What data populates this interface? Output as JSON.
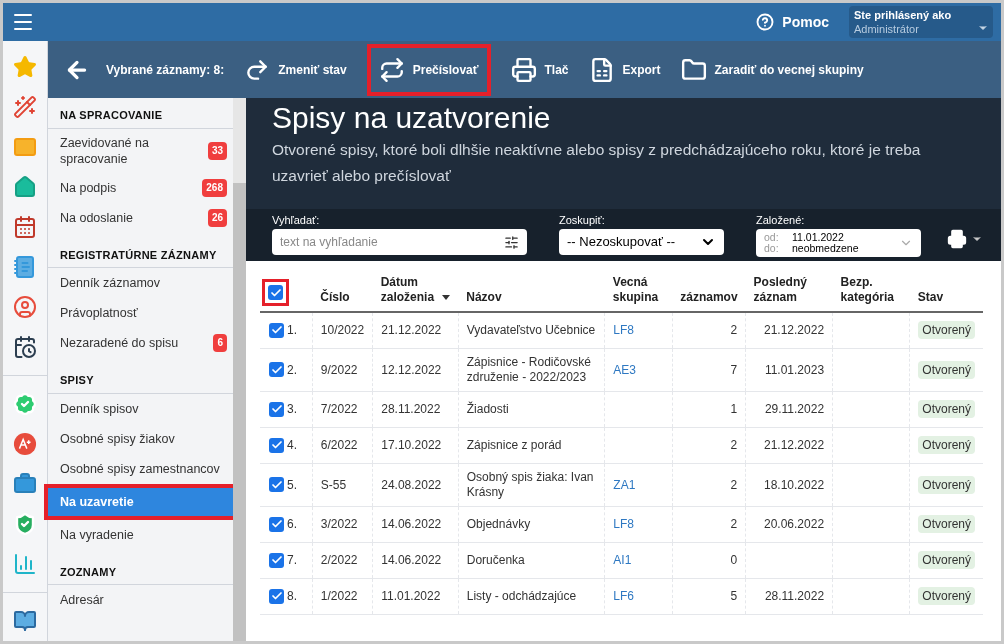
{
  "topbar": {
    "help": "Pomoc",
    "user_label": "Ste prihlásený ako",
    "user_value": "Administrátor"
  },
  "rail": [
    {
      "kind": "star"
    },
    {
      "kind": "wand"
    },
    {
      "kind": "mail"
    },
    {
      "kind": "home"
    },
    {
      "kind": "calendar"
    },
    {
      "kind": "notebook"
    },
    {
      "kind": "user"
    },
    {
      "kind": "schedule"
    },
    {
      "kind": "divider"
    },
    {
      "kind": "badge"
    },
    {
      "kind": "grade"
    },
    {
      "kind": "briefcase"
    },
    {
      "kind": "shield"
    },
    {
      "kind": "chart"
    },
    {
      "kind": "divider"
    },
    {
      "kind": "book"
    }
  ],
  "toolbar": {
    "selected_label": "Vybrané záznamy: 8:",
    "buttons": [
      {
        "kind": "redo",
        "label": "Zmeniť stav",
        "highlighted": false
      },
      {
        "kind": "renumber",
        "label": "Prečíslovať",
        "highlighted": true
      },
      {
        "kind": "print",
        "label": "Tlač",
        "highlighted": false
      },
      {
        "kind": "excel",
        "label": "Export",
        "highlighted": false
      },
      {
        "kind": "folder",
        "label": "Zaradiť do vecnej skupiny",
        "highlighted": false
      }
    ]
  },
  "sidebar": {
    "sections": [
      {
        "title": "NA SPRACOVANIE",
        "items": [
          {
            "label": "Zaevidované na spracovanie",
            "count": "33",
            "selected": false
          },
          {
            "label": "Na podpis",
            "count": "268",
            "selected": false
          },
          {
            "label": "Na odoslanie",
            "count": "26",
            "selected": false
          }
        ]
      },
      {
        "title": "REGISTRATÚRNE ZÁZNAMY",
        "items": [
          {
            "label": "Denník záznamov",
            "selected": false
          },
          {
            "label": "Právoplatnosť",
            "selected": false
          },
          {
            "label": "Nezaradené do spisu",
            "count": "6",
            "selected": false
          }
        ]
      },
      {
        "title": "SPISY",
        "items": [
          {
            "label": "Denník spisov",
            "selected": false
          },
          {
            "label": "Osobné spisy žiakov",
            "selected": false
          },
          {
            "label": "Osobné spisy zamestnancov",
            "selected": false
          },
          {
            "label": "Na uzavretie",
            "selected": true,
            "highlighted": true
          },
          {
            "label": "Na vyradenie",
            "selected": false
          }
        ]
      },
      {
        "title": "ZOZNAMY",
        "items": [
          {
            "label": "Adresár",
            "selected": false
          }
        ]
      }
    ]
  },
  "page": {
    "title": "Spisy na uzatvorenie",
    "description": "Otvorené spisy, ktoré boli dlhšie neaktívne alebo spisy z predchádzajúceho roku, ktoré je treba uzavrieť alebo prečíslovať"
  },
  "filters": {
    "search_label": "Vyhľadať:",
    "search_placeholder": "text na vyhľadanie",
    "group_label": "Zoskupiť:",
    "group_value": "-- Nezoskupovať --",
    "created_label": "Založené:",
    "from_label": "od:",
    "from_value": "11.01.2022",
    "to_label": "do:",
    "to_value": "neobmedzene"
  },
  "table": {
    "select_all": {
      "checked": true,
      "highlighted": true
    },
    "columns": [
      "Číslo",
      "Dátum založenia",
      "Názov",
      "Vecná skupina",
      "záznamov",
      "Posledný záznam",
      "Bezp. kategória",
      "Stav"
    ],
    "rows": [
      {
        "checked": true,
        "index": "1.",
        "number": "10/2022",
        "date": "21.12.2022",
        "name": "Vydavateľstvo Učebnice",
        "group": "LF8",
        "records": "2",
        "last": "21.12.2022",
        "status": "Otvorený"
      },
      {
        "checked": true,
        "index": "2.",
        "number": "9/2022",
        "date": "12.12.2022",
        "name": "Zápisnice - Rodičovské združenie - 2022/2023",
        "group": "AE3",
        "records": "7",
        "last": "11.01.2023",
        "status": "Otvorený"
      },
      {
        "checked": true,
        "index": "3.",
        "number": "7/2022",
        "date": "28.11.2022",
        "name": "Žiadosti",
        "records": "1",
        "last": "29.11.2022",
        "status": "Otvorený"
      },
      {
        "checked": true,
        "index": "4.",
        "number": "6/2022",
        "date": "17.10.2022",
        "name": "Zápisnice z porád",
        "records": "2",
        "last": "21.12.2022",
        "status": "Otvorený"
      },
      {
        "checked": true,
        "index": "5.",
        "number": "S-55",
        "date": "24.08.2022",
        "name": "Osobný spis žiaka: Ivan Krásny",
        "group": "ZA1",
        "records": "2",
        "last": "18.10.2022",
        "status": "Otvorený"
      },
      {
        "checked": true,
        "index": "6.",
        "number": "3/2022",
        "date": "14.06.2022",
        "name": "Objednávky",
        "group": "LF8",
        "records": "2",
        "last": "20.06.2022",
        "status": "Otvorený"
      },
      {
        "checked": true,
        "index": "7.",
        "number": "2/2022",
        "date": "14.06.2022",
        "name": "Doručenka",
        "group": "AI1",
        "records": "0",
        "status": "Otvorený"
      },
      {
        "checked": true,
        "index": "8.",
        "number": "1/2022",
        "date": "11.01.2022",
        "name": "Listy - odchádzajúce",
        "group": "LF6",
        "records": "5",
        "last": "28.11.2022",
        "status": "Otvorený"
      }
    ]
  }
}
